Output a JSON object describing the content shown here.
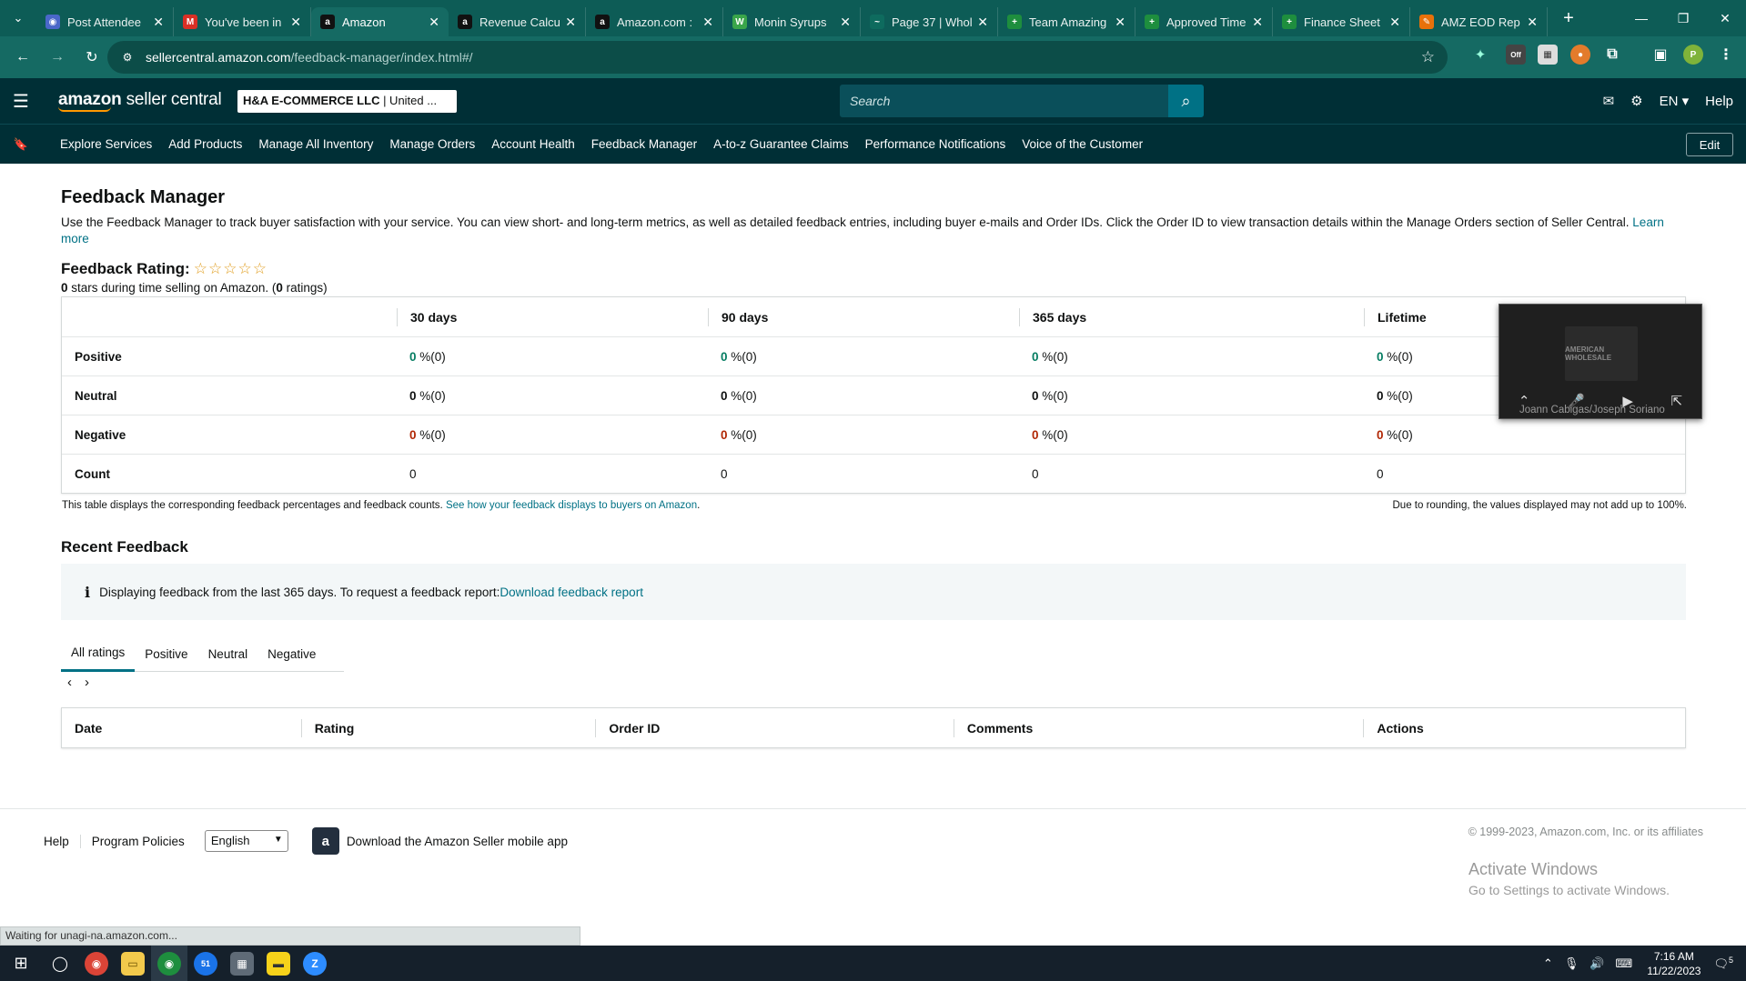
{
  "browser": {
    "tabs": [
      {
        "title": "Post Attendee",
        "color": "#4a67c9",
        "glyph": "◉"
      },
      {
        "title": "You've been in",
        "color": "#d93025",
        "glyph": "M"
      },
      {
        "title": "Amazon",
        "color": "#111111",
        "glyph": "a"
      },
      {
        "title": "Revenue Calcu",
        "color": "#111111",
        "glyph": "a"
      },
      {
        "title": "Amazon.com :",
        "color": "#111111",
        "glyph": "a"
      },
      {
        "title": "Monin Syrups",
        "color": "#3aa54a",
        "glyph": "W"
      },
      {
        "title": "Page 37 | Whol",
        "color": "#0e6b5e",
        "glyph": "~"
      },
      {
        "title": "Team Amazing",
        "color": "#1e8e3e",
        "glyph": "+"
      },
      {
        "title": "Approved Time",
        "color": "#1e8e3e",
        "glyph": "+"
      },
      {
        "title": "Finance Sheet",
        "color": "#1e8e3e",
        "glyph": "+"
      },
      {
        "title": "AMZ EOD Rep",
        "color": "#e8710a",
        "glyph": "✎"
      }
    ],
    "active_tab": 2,
    "url_host": "sellercentral.amazon.com",
    "url_path": "/feedback-manager/index.html#/",
    "extension_off_label": "Off",
    "profile_initial": "P"
  },
  "header": {
    "logo_main": "amazon",
    "logo_sub": " seller central",
    "account_name": "H&A E-COMMERCE LLC",
    "account_region": " | United ...",
    "search_placeholder": "Search",
    "language": "EN",
    "help": "Help"
  },
  "nav": {
    "items": [
      "Explore Services",
      "Add Products",
      "Manage All Inventory",
      "Manage Orders",
      "Account Health",
      "Feedback Manager",
      "A-to-z Guarantee Claims",
      "Performance Notifications",
      "Voice of the Customer"
    ],
    "edit": "Edit"
  },
  "page": {
    "title": "Feedback Manager",
    "intro": "Use the Feedback Manager to track buyer satisfaction with your service. You can view short- and long-term metrics, as well as detailed feedback entries, including buyer e-mails and Order IDs. Click the Order ID to view transaction details within the Manage Orders section of Seller Central. ",
    "learn_more": "Learn more",
    "rating_label": "Feedback Rating:",
    "rating_stars": 0,
    "rating_summary_stars": "0",
    "rating_summary_text": " stars during time selling on Amazon. (",
    "rating_summary_count": "0",
    "rating_summary_end": " ratings)"
  },
  "feedback_table": {
    "columns": [
      "",
      "30 days",
      "90 days",
      "365 days",
      "Lifetime"
    ],
    "rows": [
      {
        "label": "Positive",
        "kind": "pos",
        "cells": [
          {
            "pct": "0",
            "suffix": " %(0)"
          },
          {
            "pct": "0",
            "suffix": " %(0)"
          },
          {
            "pct": "0",
            "suffix": " %(0)"
          },
          {
            "pct": "0",
            "suffix": " %(0)"
          }
        ]
      },
      {
        "label": "Neutral",
        "kind": "neu",
        "cells": [
          {
            "pct": "0",
            "suffix": " %(0)"
          },
          {
            "pct": "0",
            "suffix": " %(0)"
          },
          {
            "pct": "0",
            "suffix": " %(0)"
          },
          {
            "pct": "0",
            "suffix": " %(0)"
          }
        ]
      },
      {
        "label": "Negative",
        "kind": "neg",
        "cells": [
          {
            "pct": "0",
            "suffix": " %(0)"
          },
          {
            "pct": "0",
            "suffix": " %(0)"
          },
          {
            "pct": "0",
            "suffix": " %(0)"
          },
          {
            "pct": "0",
            "suffix": " %(0)"
          }
        ]
      },
      {
        "label": "Count",
        "kind": "count",
        "cells": [
          {
            "pct": "0",
            "suffix": ""
          },
          {
            "pct": "0",
            "suffix": ""
          },
          {
            "pct": "0",
            "suffix": ""
          },
          {
            "pct": "0",
            "suffix": ""
          }
        ]
      }
    ],
    "note_left": "This table displays the corresponding feedback percentages and feedback counts. ",
    "note_link": "See how your feedback displays to buyers on Amazon",
    "note_right": "Due to rounding, the values displayed may not add up to 100%."
  },
  "recent": {
    "title": "Recent Feedback",
    "info_text": "Displaying feedback from the last 365 days. To request a feedback report: ",
    "info_link": "Download feedback report",
    "tabs": [
      "All ratings",
      "Positive",
      "Neutral",
      "Negative"
    ],
    "active_tab": 0,
    "columns": [
      "Date",
      "Rating",
      "Order ID",
      "Comments",
      "Actions"
    ]
  },
  "zoom": {
    "participant": "Joann Cabigas/Joseph Soriano",
    "thumb_label": "AMERICAN WHOLESALE"
  },
  "footer": {
    "help": "Help",
    "policies": "Program Policies",
    "language": "English",
    "app_text": "Download the Amazon Seller mobile app",
    "copyright": "© 1999-2023, Amazon.com, Inc. or its affiliates",
    "activate_title": "Activate Windows",
    "activate_sub": "Go to Settings to activate Windows."
  },
  "status": "Waiting for unagi-na.amazon.com...",
  "taskbar": {
    "time": "7:16 AM",
    "date": "11/22/2023",
    "notif_count": "5",
    "mail_badge": "51"
  }
}
